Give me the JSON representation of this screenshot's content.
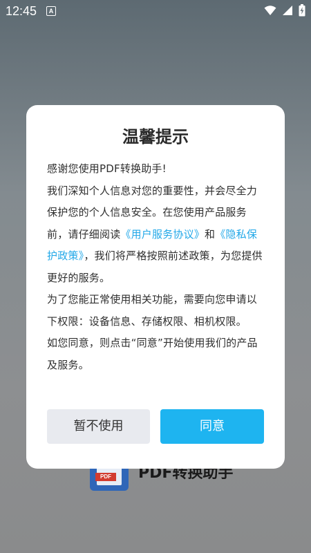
{
  "status_bar": {
    "time": "12:45",
    "notification_icon": "A"
  },
  "background_app": {
    "logo_tag": "PDF",
    "title": "PDF转换助手"
  },
  "dialog": {
    "title": "温馨提示",
    "greeting": "感谢您使用PDF转换助手!",
    "paragraph1_part1": "我们深知个人信息对您的重要性，并会尽全力保护您的个人信息安全。在您使用产品服务前，请仔细阅读",
    "user_agreement_link": "《用户服务协议》",
    "conjunction": "和",
    "privacy_policy_link": "《隐私保护政策》",
    "paragraph1_part2": "，我们将严格按照前述政策，为您提供更好的服务。",
    "paragraph2": "为了您能正常使用相关功能，需要向您申请以下权限：设备信息、存储权限、相机权限。",
    "paragraph3": "如您同意，则点击“同意”开始使用我们的产品及服务。",
    "decline_button": "暂不使用",
    "agree_button": "同意"
  },
  "colors": {
    "link": "#22a8e8",
    "agree_button": "#1eb4f0",
    "decline_button": "#e8eaef"
  },
  "icons": [
    "wifi-icon",
    "signal-icon",
    "battery-charging-icon"
  ]
}
